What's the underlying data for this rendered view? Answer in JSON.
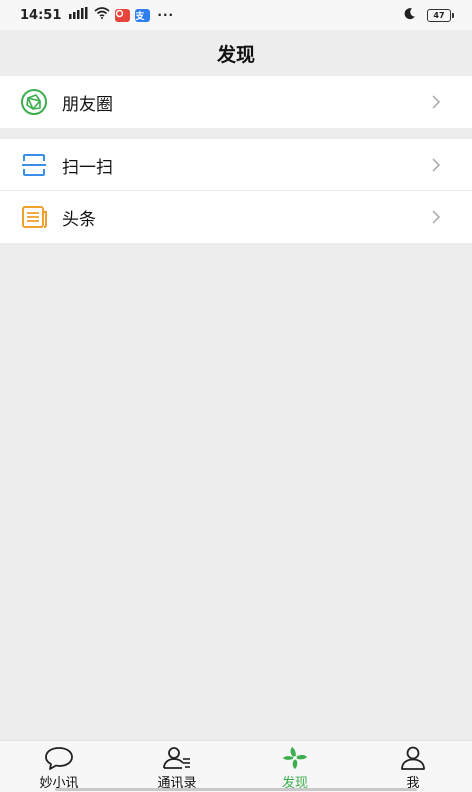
{
  "status_bar": {
    "time": "14:51",
    "battery": "47",
    "app_icon_1": "app-icon-red",
    "app_icon_2_text": "支",
    "more": "···"
  },
  "header": {
    "title": "发现"
  },
  "groups": [
    {
      "items": [
        {
          "label": "朋友圈",
          "icon": "moments-icon"
        }
      ]
    },
    {
      "items": [
        {
          "label": "扫一扫",
          "icon": "scan-icon"
        },
        {
          "label": "头条",
          "icon": "news-icon"
        }
      ]
    }
  ],
  "tabs": [
    {
      "label": "妙小讯",
      "icon": "chat-bubble-icon",
      "active": false
    },
    {
      "label": "通讯录",
      "icon": "contacts-icon",
      "active": false
    },
    {
      "label": "发现",
      "icon": "discover-icon",
      "active": true
    },
    {
      "label": "我",
      "icon": "profile-icon",
      "active": false
    }
  ],
  "colors": {
    "accent_green": "#3cae4e",
    "scan_blue": "#3a8ee6",
    "news_orange": "#f0a030",
    "background": "#ededed"
  }
}
